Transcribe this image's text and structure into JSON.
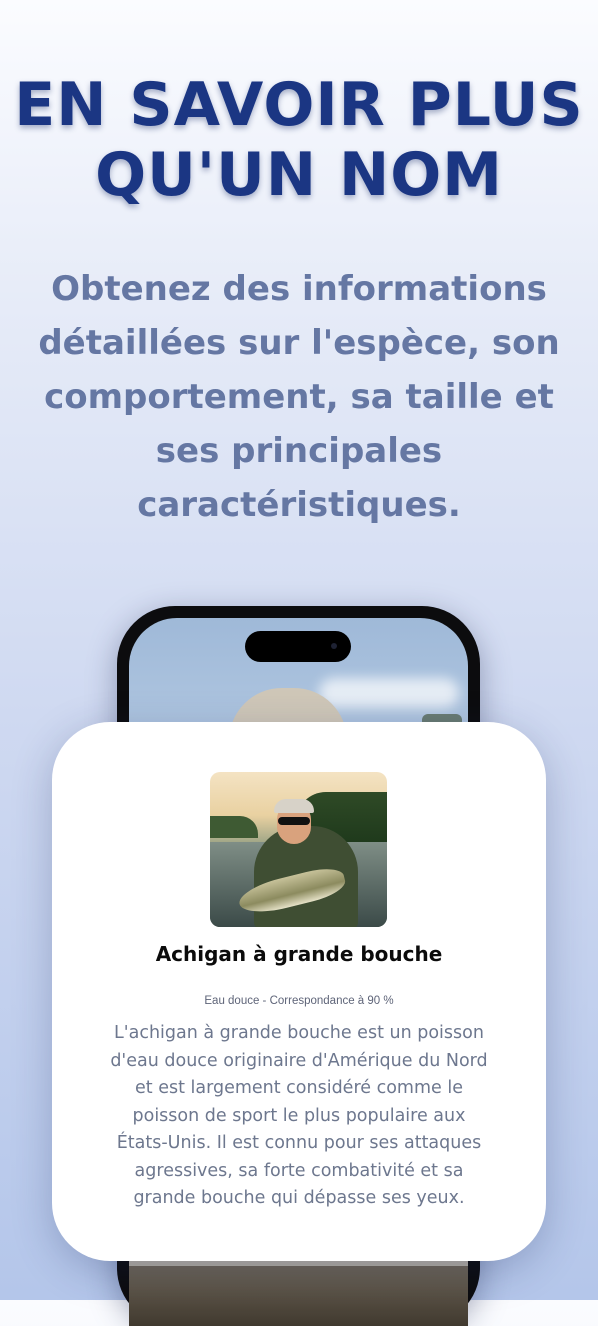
{
  "hero": {
    "title": "EN SAVOIR PLUS\nQU'UN NOM",
    "subtitle": "Obtenez des informations détaillées sur l'espèce, son comportement, sa taille et ses principales caractéristiques."
  },
  "species_card": {
    "name": "Achigan à grande bouche",
    "meta": "Eau douce - Correspondance à 90 %",
    "description": "L'achigan à grande bouche est un poisson d'eau douce originaire d'Amérique du Nord et est largement considéré comme le poisson de sport le plus populaire aux États-Unis. Il est connu pour ses attaques agressives, sa forte combativité et sa grande bouche qui dépasse ses yeux."
  },
  "colors": {
    "title": "#1b3683",
    "subtitle": "#6577a3",
    "background_top": "#fbfcff",
    "background_bottom": "#b4c6ea",
    "card": "#ffffff",
    "description_text": "#6d778e"
  }
}
